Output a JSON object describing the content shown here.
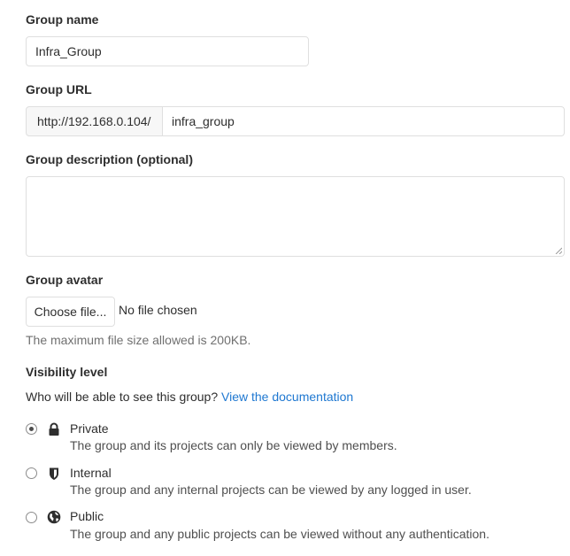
{
  "group_name": {
    "label": "Group name",
    "value": "Infra_Group"
  },
  "group_url": {
    "label": "Group URL",
    "prefix": "http://192.168.0.104/",
    "value": "infra_group"
  },
  "group_description": {
    "label": "Group description (optional)",
    "value": ""
  },
  "group_avatar": {
    "label": "Group avatar",
    "choose_file_label": "Choose file...",
    "file_status": "No file chosen",
    "help": "The maximum file size allowed is 200KB."
  },
  "visibility": {
    "label": "Visibility level",
    "question": "Who will be able to see this group?",
    "doc_link": "View the documentation",
    "options": [
      {
        "title": "Private",
        "description": "The group and its projects can only be viewed by members.",
        "icon": "lock-icon",
        "checked": true
      },
      {
        "title": "Internal",
        "description": "The group and any internal projects can be viewed by any logged in user.",
        "icon": "shield-icon",
        "checked": false
      },
      {
        "title": "Public",
        "description": "The group and any public projects can be viewed without any authentication.",
        "icon": "globe-icon",
        "checked": false
      }
    ]
  }
}
